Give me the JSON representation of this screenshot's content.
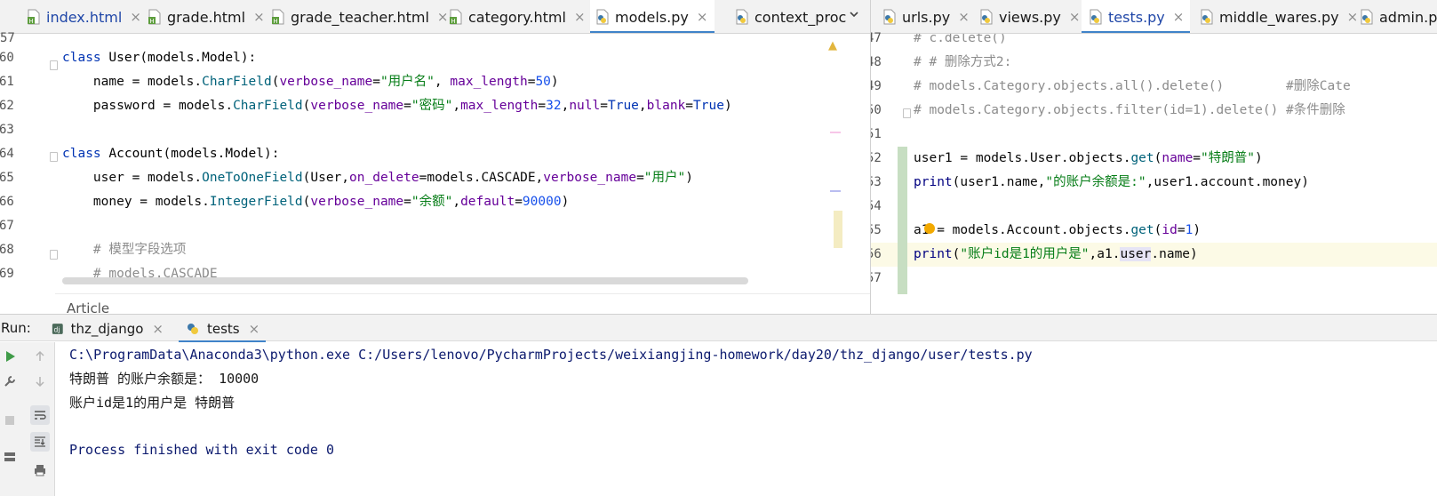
{
  "left_editor": {
    "tabs": [
      {
        "label": "index.html",
        "icon": "html-file-icon",
        "active": false,
        "blue": true
      },
      {
        "label": "grade.html",
        "icon": "html-file-icon",
        "active": false
      },
      {
        "label": "grade_teacher.html",
        "icon": "html-file-icon",
        "active": false
      },
      {
        "label": "category.html",
        "icon": "html-file-icon",
        "active": false
      },
      {
        "label": "models.py",
        "icon": "python-file-icon",
        "active": true
      },
      {
        "label": "context_proc",
        "icon": "python-file-icon",
        "active": false
      }
    ],
    "line_numbers": [
      "57",
      "60",
      "61",
      "62",
      "63",
      "64",
      "65",
      "66",
      "67",
      "68",
      "69"
    ],
    "lines": [
      {
        "no": "60",
        "tokens": [
          [
            "kw",
            "class "
          ],
          [
            "cls",
            "User"
          ],
          [
            "p",
            "("
          ],
          [
            "cls",
            "models.Model"
          ],
          [
            "p",
            "):"
          ]
        ]
      },
      {
        "no": "61",
        "tokens": [
          [
            "p",
            "    name = models."
          ],
          [
            "fn",
            "CharField"
          ],
          [
            "p",
            "("
          ],
          [
            "kwarg",
            "verbose_name"
          ],
          [
            "p",
            "="
          ],
          [
            "str",
            "\"用户名\""
          ],
          [
            "p",
            ", "
          ],
          [
            "kwarg",
            "max_length"
          ],
          [
            "p",
            "="
          ],
          [
            "num",
            "50"
          ],
          [
            "p",
            ")"
          ]
        ]
      },
      {
        "no": "62",
        "tokens": [
          [
            "p",
            "    password = models."
          ],
          [
            "fn",
            "CharField"
          ],
          [
            "p",
            "("
          ],
          [
            "kwarg",
            "verbose_name"
          ],
          [
            "p",
            "="
          ],
          [
            "str",
            "\"密码\""
          ],
          [
            "p",
            ","
          ],
          [
            "kwarg",
            "max_length"
          ],
          [
            "p",
            "="
          ],
          [
            "num",
            "32"
          ],
          [
            "p",
            ","
          ],
          [
            "kwarg",
            "null"
          ],
          [
            "p",
            "="
          ],
          [
            "kw",
            "True"
          ],
          [
            "p",
            ","
          ],
          [
            "kwarg",
            "blank"
          ],
          [
            "p",
            "="
          ],
          [
            "kw",
            "True"
          ],
          [
            "p",
            ")"
          ]
        ]
      },
      {
        "no": "63",
        "tokens": []
      },
      {
        "no": "64",
        "tokens": [
          [
            "kw",
            "class "
          ],
          [
            "cls",
            "Account"
          ],
          [
            "p",
            "("
          ],
          [
            "cls",
            "models.Model"
          ],
          [
            "p",
            "):"
          ]
        ]
      },
      {
        "no": "65",
        "tokens": [
          [
            "p",
            "    user = models."
          ],
          [
            "fn",
            "OneToOneField"
          ],
          [
            "p",
            "(User,"
          ],
          [
            "kwarg",
            "on_delete"
          ],
          [
            "p",
            "=models.CASCADE,"
          ],
          [
            "kwarg",
            "verbose_name"
          ],
          [
            "p",
            "="
          ],
          [
            "str",
            "\"用户\""
          ],
          [
            "p",
            ")"
          ]
        ]
      },
      {
        "no": "66",
        "tokens": [
          [
            "p",
            "    money = models."
          ],
          [
            "fn",
            "IntegerField"
          ],
          [
            "p",
            "("
          ],
          [
            "kwarg",
            "verbose_name"
          ],
          [
            "p",
            "="
          ],
          [
            "str",
            "\"余额\""
          ],
          [
            "p",
            ","
          ],
          [
            "kwarg",
            "default"
          ],
          [
            "p",
            "="
          ],
          [
            "num",
            "90000"
          ],
          [
            "p",
            ")"
          ]
        ]
      },
      {
        "no": "67",
        "tokens": []
      },
      {
        "no": "68",
        "tokens": [
          [
            "cm",
            "    # 模型字段选项"
          ]
        ]
      },
      {
        "no": "69",
        "tokens": [
          [
            "cm",
            "    # models.CASCADE"
          ]
        ]
      }
    ],
    "breadcrumb": "Article"
  },
  "right_editor": {
    "tabs": [
      {
        "label": "urls.py",
        "icon": "python-file-icon",
        "active": false
      },
      {
        "label": "views.py",
        "icon": "python-file-icon",
        "active": false
      },
      {
        "label": "tests.py",
        "icon": "python-file-icon",
        "active": true
      },
      {
        "label": "middle_wares.py",
        "icon": "python-file-icon",
        "active": false
      },
      {
        "label": "admin.py",
        "icon": "python-file-icon",
        "active": false
      }
    ],
    "lines": [
      {
        "no": "47",
        "tokens": [
          [
            "cm",
            "# c.delete()"
          ]
        ]
      },
      {
        "no": "48",
        "tokens": [
          [
            "cm",
            "# # 删除方式2:"
          ]
        ]
      },
      {
        "no": "49",
        "tokens": [
          [
            "cm",
            "# models.Category.objects.all().delete()        #删除Cate"
          ]
        ]
      },
      {
        "no": "50",
        "tokens": [
          [
            "cm",
            "# models.Category.objects.filter(id=1).delete() #条件删除"
          ]
        ]
      },
      {
        "no": "51",
        "tokens": []
      },
      {
        "no": "52",
        "tokens": [
          [
            "p",
            "user1 = models.User.objects."
          ],
          [
            "fn",
            "get"
          ],
          [
            "p",
            "("
          ],
          [
            "kwarg",
            "name"
          ],
          [
            "p",
            "="
          ],
          [
            "str",
            "\"特朗普\""
          ],
          [
            "p",
            ")"
          ]
        ]
      },
      {
        "no": "53",
        "tokens": [
          [
            "builtin",
            "print"
          ],
          [
            "p",
            "(user1.name,"
          ],
          [
            "str",
            "\"的账户余额是:\""
          ],
          [
            "p",
            ",user1.account.money)"
          ]
        ]
      },
      {
        "no": "54",
        "tokens": []
      },
      {
        "no": "55",
        "tokens": [
          [
            "p",
            "a1 = models.Account.objects."
          ],
          [
            "fn",
            "get"
          ],
          [
            "p",
            "("
          ],
          [
            "kwarg",
            "id"
          ],
          [
            "p",
            "="
          ],
          [
            "num",
            "1"
          ],
          [
            "p",
            ")"
          ]
        ]
      },
      {
        "no": "56",
        "tokens": [
          [
            "builtin",
            "print"
          ],
          [
            "p",
            "("
          ],
          [
            "str",
            "\"账户id是1的用户是\""
          ],
          [
            "p",
            ",a1."
          ],
          [
            "hl",
            "user"
          ],
          [
            "p",
            ".name)"
          ]
        ]
      },
      {
        "no": "57",
        "tokens": []
      }
    ],
    "current_line": "56"
  },
  "run_panel": {
    "label": "Run:",
    "tabs": [
      {
        "label": "thz_django",
        "icon": "django-icon",
        "active": false
      },
      {
        "label": "tests",
        "icon": "python-file-icon",
        "active": true
      }
    ],
    "console": {
      "command": "C:\\ProgramData\\Anaconda3\\python.exe C:/Users/lenovo/PycharmProjects/weixiangjing-homework/day20/thz_django/user/tests.py",
      "output": [
        "特朗普 的账户余额是： 10000",
        "账户id是1的用户是 特朗普",
        ""
      ],
      "exit": "Process finished with exit code 0"
    }
  },
  "colors": {
    "accent": "#4083c9",
    "keyword": "#0033b3",
    "string": "#067d17",
    "number": "#1750eb",
    "comment": "#8c8c8c",
    "function": "#00627a",
    "kwarg": "#660099"
  }
}
